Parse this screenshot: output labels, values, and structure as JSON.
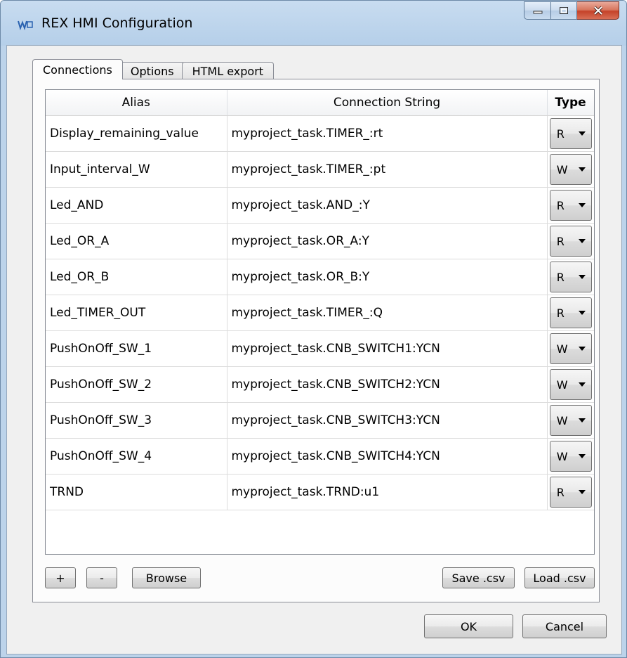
{
  "window": {
    "title": "REX HMI Configuration"
  },
  "tabs": [
    {
      "label": "Connections"
    },
    {
      "label": "Options"
    },
    {
      "label": "HTML export"
    }
  ],
  "table": {
    "columns": [
      "Alias",
      "Connection String",
      "Type"
    ],
    "rows": [
      {
        "alias": "Display_remaining_value",
        "connection": "myproject_task.TIMER_:rt",
        "type": "R"
      },
      {
        "alias": "Input_interval_W",
        "connection": "myproject_task.TIMER_:pt",
        "type": "W"
      },
      {
        "alias": "Led_AND",
        "connection": "myproject_task.AND_:Y",
        "type": "R"
      },
      {
        "alias": "Led_OR_A",
        "connection": "myproject_task.OR_A:Y",
        "type": "R"
      },
      {
        "alias": "Led_OR_B",
        "connection": "myproject_task.OR_B:Y",
        "type": "R"
      },
      {
        "alias": "Led_TIMER_OUT",
        "connection": "myproject_task.TIMER_:Q",
        "type": "R"
      },
      {
        "alias": "PushOnOff_SW_1",
        "connection": "myproject_task.CNB_SWITCH1:YCN",
        "type": "W"
      },
      {
        "alias": "PushOnOff_SW_2",
        "connection": "myproject_task.CNB_SWITCH2:YCN",
        "type": "W"
      },
      {
        "alias": "PushOnOff_SW_3",
        "connection": "myproject_task.CNB_SWITCH3:YCN",
        "type": "W"
      },
      {
        "alias": "PushOnOff_SW_4",
        "connection": "myproject_task.CNB_SWITCH4:YCN",
        "type": "W"
      },
      {
        "alias": "TRND",
        "connection": "myproject_task.TRND:u1",
        "type": "R"
      }
    ]
  },
  "buttons": {
    "add": "+",
    "remove": "-",
    "browse": "Browse",
    "save_csv": "Save .csv",
    "load_csv": "Load .csv",
    "ok": "OK",
    "cancel": "Cancel"
  },
  "colors": {
    "frame": "#bcd3ea",
    "client": "#f0f0f0",
    "close_button": "#c5432a"
  }
}
